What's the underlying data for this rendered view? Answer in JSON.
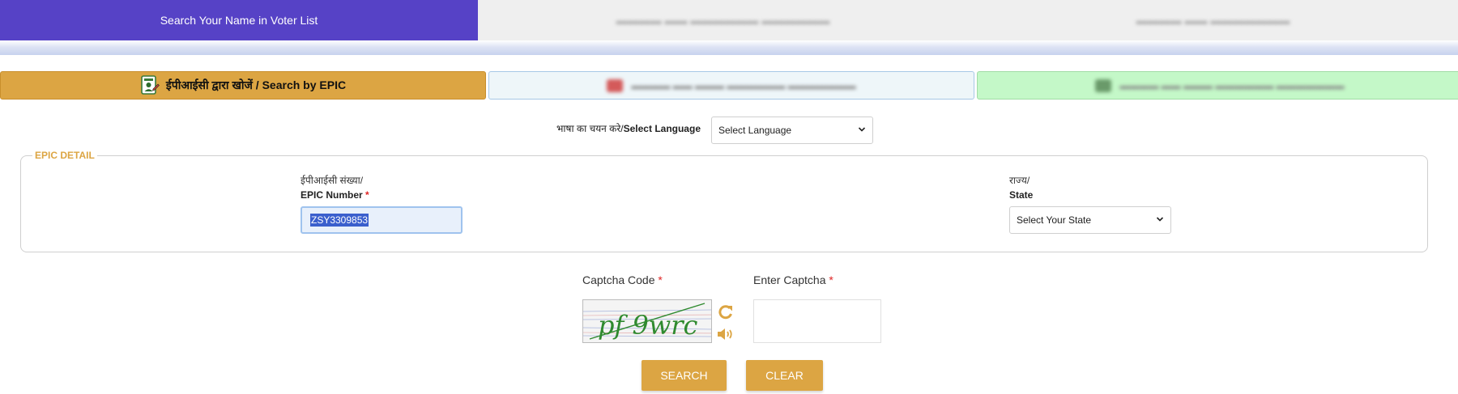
{
  "top_tabs": {
    "active_label": "Search Your Name in Voter List"
  },
  "sub_tabs": {
    "epic_label": "ईपीआईसी द्वारा खोजें / Search by EPIC"
  },
  "language": {
    "label_hi": "भाषा का चयन करे/",
    "label_en": "Select Language",
    "selected": "Select Language"
  },
  "epic_detail": {
    "legend": "EPIC DETAIL",
    "epic_label_hi": "ईपीआईसी संख्या/",
    "epic_label_en": "EPIC Number",
    "epic_value": "ZSY3309853",
    "state_label_hi": "राज्य/",
    "state_label_en": "State",
    "state_selected": "Select Your State"
  },
  "captcha": {
    "code_label": "Captcha Code",
    "enter_label": "Enter Captcha",
    "image_text": "pf 9wrc",
    "required_mark": "*"
  },
  "buttons": {
    "search": "SEARCH",
    "clear": "CLEAR"
  },
  "colors": {
    "primary_purple": "#5642c6",
    "accent_gold": "#dca543",
    "required_red": "#e02424"
  }
}
